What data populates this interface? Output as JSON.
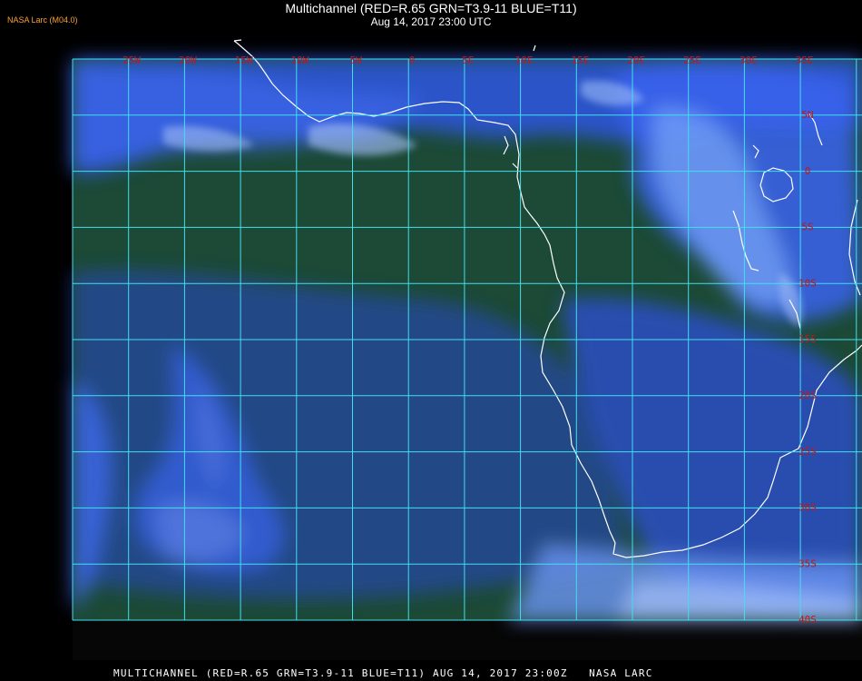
{
  "header": {
    "credit": "NASA Larc (M04.0)",
    "title": "Multichannel (RED=R.65 GRN=T3.9-11 BLUE=T11)",
    "subtitle": "Aug 14, 2017 23:00 UTC"
  },
  "footer": {
    "caption": "MULTICHANNEL (RED=R.65 GRN=T3.9-11 BLUE=T11) AUG 14, 2017 23:00Z   NASA LARC"
  },
  "map": {
    "lon_labels": [
      "25W",
      "20W",
      "15W",
      "10W",
      "5W",
      "0",
      "5E",
      "10E",
      "15E",
      "20E",
      "25E",
      "30E",
      "35E"
    ],
    "lat_labels": [
      "5N",
      "0",
      "5S",
      "10S",
      "15S",
      "20S",
      "25S",
      "30S",
      "35S",
      "40S"
    ],
    "colors": {
      "grid": "#40e0f0",
      "label": "#c01818",
      "coast": "#ffffff",
      "ocean_clear": "#1a4a34",
      "cloud_low": "#2a50d8",
      "cloud_high": "#6ea0f8"
    }
  }
}
